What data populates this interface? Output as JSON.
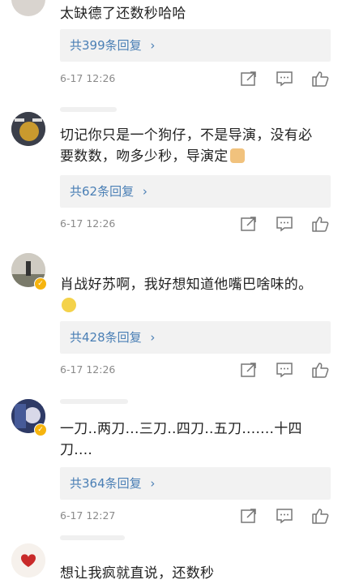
{
  "comments": [
    {
      "text": "太缺德了还数秒哈哈",
      "reply_summary": "共399条回复",
      "time": "6-17 12:26"
    },
    {
      "text": "切记你只是一个狗仔，不是导演，没有必要数数，吻多少秒，导演定",
      "emoji": "cat-face-emoji",
      "reply_summary": "共62条回复",
      "time": "6-17 12:26"
    },
    {
      "text": "肖战好苏啊，我好想知道他嘴巴啥味的。",
      "emoji": "pleading-face-emoji",
      "reply_summary": "共428条回复",
      "time": "6-17 12:26"
    },
    {
      "text": "一刀..两刀...三刀..四刀..五刀.......十四刀....",
      "reply_summary": "共364条回复",
      "time": "6-17 12:27"
    },
    {
      "text": "想让我疯就直说，还数秒"
    }
  ],
  "colors": {
    "reply_link": "#4a7fb5",
    "reply_bg": "#f2f2f2",
    "badge": "#f6b40e",
    "meta": "#8a8a8a"
  },
  "icons": [
    "reply-arrow",
    "chevron-right-icon",
    "share-icon",
    "comment-icon",
    "like-icon"
  ],
  "chevron": "›"
}
